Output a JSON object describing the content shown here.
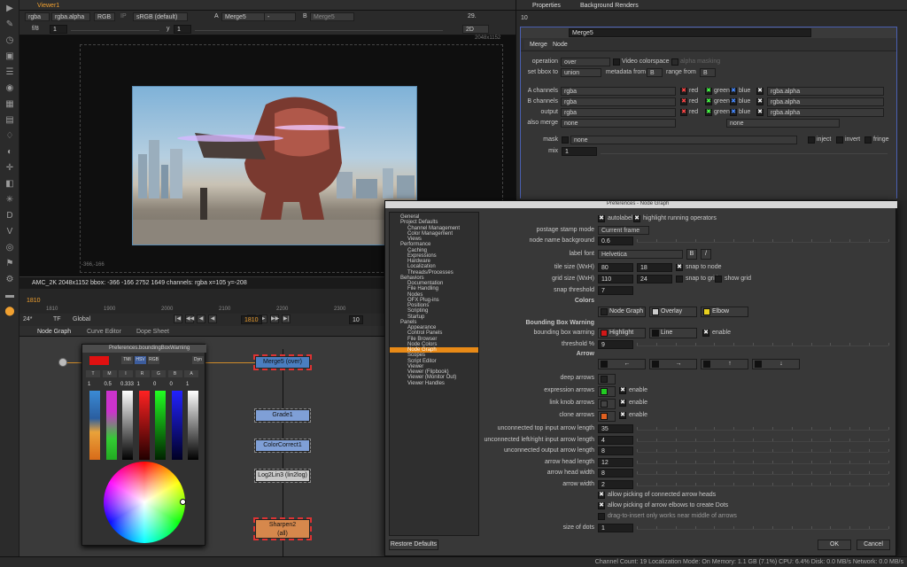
{
  "viewer": {
    "tab": "Viewer1",
    "channels": "rgba",
    "alpha": "rgba.alpha",
    "mode": "RGB",
    "ip": "IP",
    "colorspace": "sRGB (default)",
    "a_input": "Merge5",
    "a_label": "A",
    "b_op": "-",
    "b_label": "B",
    "b_input": "Merge5",
    "fps": "29.",
    "fstop": "f/8",
    "frame_y": "1",
    "y_label": "y",
    "y_val": "1",
    "view": "2D",
    "res_label": "2048x1152",
    "coord_label": "-366,-166",
    "status": "AMC_2K 2048x1152  bbox: -366 -166 2752 1649 channels: rgba        x=105 y=-208",
    "timeline_ticks": [
      "1810",
      "1900",
      "2000",
      "2100",
      "2200",
      "2300",
      "2400"
    ],
    "frame_marker": "1810",
    "tb_fps": "24*",
    "tb_tf": "TF",
    "tb_global": "Global",
    "cur_frame": "1810",
    "step": "10"
  },
  "left_tools": [
    "viewer-icon",
    "paint-icon",
    "clock-icon",
    "toggle-icon",
    "layers-icon",
    "color-icon",
    "channel-icon",
    "filter-icon",
    "keyer-icon",
    "merge-icon",
    "transform-icon",
    "3d-icon",
    "particles-icon",
    "deep-icon",
    "views-icon",
    "metadata-icon",
    "toolsets-icon",
    "other-icon",
    "furnace-icon",
    "nuke-icon"
  ],
  "node_graph": {
    "tabs": [
      "Node Graph",
      "Curve Editor",
      "Dope Sheet"
    ],
    "nodes": [
      "Merge5 (over)",
      "Grade1",
      "ColorCorrect1",
      "Log2Lin3 (lin2log)",
      "Sharpen2",
      "(all)"
    ]
  },
  "color_picker": {
    "title": "Preferences.boundingBoxWarning",
    "modes": [
      "TMI",
      "HSV",
      "RGB"
    ],
    "dyn": "Dyn",
    "row_labels": [
      "T",
      "M",
      "I",
      "R",
      "G",
      "B",
      "A"
    ],
    "values": [
      "1",
      "0.5",
      "0.333",
      "1",
      "0",
      "0",
      "1"
    ]
  },
  "properties": {
    "tabs": [
      "Properties",
      "Background Renders"
    ],
    "max": "10",
    "node_name": "Merge5",
    "subtabs": [
      "Merge",
      "Node"
    ],
    "operation_label": "operation",
    "operation": "over",
    "video_colorspace": "Video colorspace",
    "alpha_masking": "alpha masking",
    "bbox_label": "set bbox to",
    "bbox": "union",
    "metadata_label": "metadata from",
    "metadata": "B",
    "range_label": "range from",
    "range": "B",
    "a_channels_label": "A channels",
    "a_channels": "rgba",
    "b_channels_label": "B channels",
    "b_channels": "rgba",
    "output_label": "output",
    "output": "rgba",
    "also_merge_label": "also merge",
    "also_merge": "none",
    "also_merge2": "none",
    "rgb": [
      "red",
      "green",
      "blue"
    ],
    "alpha": "rgba.alpha",
    "mask_label": "mask",
    "mask": "none",
    "inject": "inject",
    "invert": "invert",
    "fringe": "fringe",
    "mix_label": "mix",
    "mix": "1"
  },
  "prefs": {
    "title": "Preferences - Node Graph",
    "tree": [
      {
        "t": "General",
        "l": 0
      },
      {
        "t": "Project Defaults",
        "l": 0
      },
      {
        "t": "Channel Management",
        "l": 1
      },
      {
        "t": "Color Management",
        "l": 1
      },
      {
        "t": "Views",
        "l": 1
      },
      {
        "t": "Performance",
        "l": 0
      },
      {
        "t": "Caching",
        "l": 1
      },
      {
        "t": "Expressions",
        "l": 1
      },
      {
        "t": "Hardware",
        "l": 1
      },
      {
        "t": "Localization",
        "l": 1
      },
      {
        "t": "Threads/Processes",
        "l": 1
      },
      {
        "t": "Behaviors",
        "l": 0
      },
      {
        "t": "Documentation",
        "l": 1
      },
      {
        "t": "File Handling",
        "l": 1
      },
      {
        "t": "Nodes",
        "l": 1
      },
      {
        "t": "OFX Plug-ins",
        "l": 1
      },
      {
        "t": "Positions",
        "l": 1
      },
      {
        "t": "Scripting",
        "l": 1
      },
      {
        "t": "Startup",
        "l": 1
      },
      {
        "t": "Panels",
        "l": 0
      },
      {
        "t": "Appearance",
        "l": 1
      },
      {
        "t": "Control Panels",
        "l": 1
      },
      {
        "t": "File Browser",
        "l": 1
      },
      {
        "t": "Node Colors",
        "l": 1
      },
      {
        "t": "Node Graph",
        "l": 1,
        "sel": true
      },
      {
        "t": "Scopes",
        "l": 1
      },
      {
        "t": "Script Editor",
        "l": 1
      },
      {
        "t": "Viewer",
        "l": 1
      },
      {
        "t": "Viewer (Flipbook)",
        "l": 1
      },
      {
        "t": "Viewer (Monitor Out)",
        "l": 1
      },
      {
        "t": "Viewer Handles",
        "l": 1
      }
    ],
    "autolabel": "autolabel",
    "highlight_running": "highlight running operators",
    "postage_label": "postage stamp mode",
    "postage": "Current frame",
    "nnb_label": "node name background",
    "nnb": "0.6",
    "font_label": "label font",
    "font": "Helvetica",
    "tile_label": "tile size (WxH)",
    "tile_w": "80",
    "tile_h": "18",
    "snap_node": "snap to node",
    "grid_label": "grid size (WxH)",
    "grid_w": "110",
    "grid_h": "24",
    "snap_grid": "snap to grid",
    "show_grid": "show grid",
    "snap_thresh_label": "snap threshold",
    "snap_thresh": "7",
    "colors_head": "Colors",
    "c_nodegraph": "Node Graph",
    "c_overlay": "Overlay",
    "c_elbow": "Elbow",
    "bbw_head": "Bounding Box Warning",
    "bbw_label": "bounding box warning",
    "bbw_highlight": "Highlight",
    "bbw_line": "Line",
    "bbw_enable": "enable",
    "thresh_label": "threshold %",
    "thresh": "9",
    "arrow_head": "Arrow",
    "arrows": [
      "←",
      "→",
      "↑",
      "↓"
    ],
    "deep_label": "deep arrows",
    "expr_label": "expression arrows",
    "link_label": "link knob arrows",
    "clone_label": "clone arrows",
    "enable": "enable",
    "len_rows": [
      {
        "l": "unconnected top input arrow length",
        "v": "35"
      },
      {
        "l": "unconnected left/right input arrow length",
        "v": "4"
      },
      {
        "l": "unconnected output arrow length",
        "v": "8"
      },
      {
        "l": "arrow head length",
        "v": "12"
      },
      {
        "l": "arrow head width",
        "v": "8"
      },
      {
        "l": "arrow width",
        "v": "2"
      }
    ],
    "allow1": "allow picking of connected arrow heads",
    "allow2": "allow picking of arrow elbows to create Dots",
    "drag_insert": "drag-to-insert only works near middle of arrows",
    "dots_label": "size of dots",
    "dots": "1",
    "restore": "Restore Defaults",
    "ok": "OK",
    "cancel": "Cancel"
  },
  "statusbar": "Channel Count: 19  Localization Mode: On  Memory: 1.1 GB (7.1%)  CPU: 6.4%  Disk: 0.0 MB/s  Network: 0.0 MB/s"
}
